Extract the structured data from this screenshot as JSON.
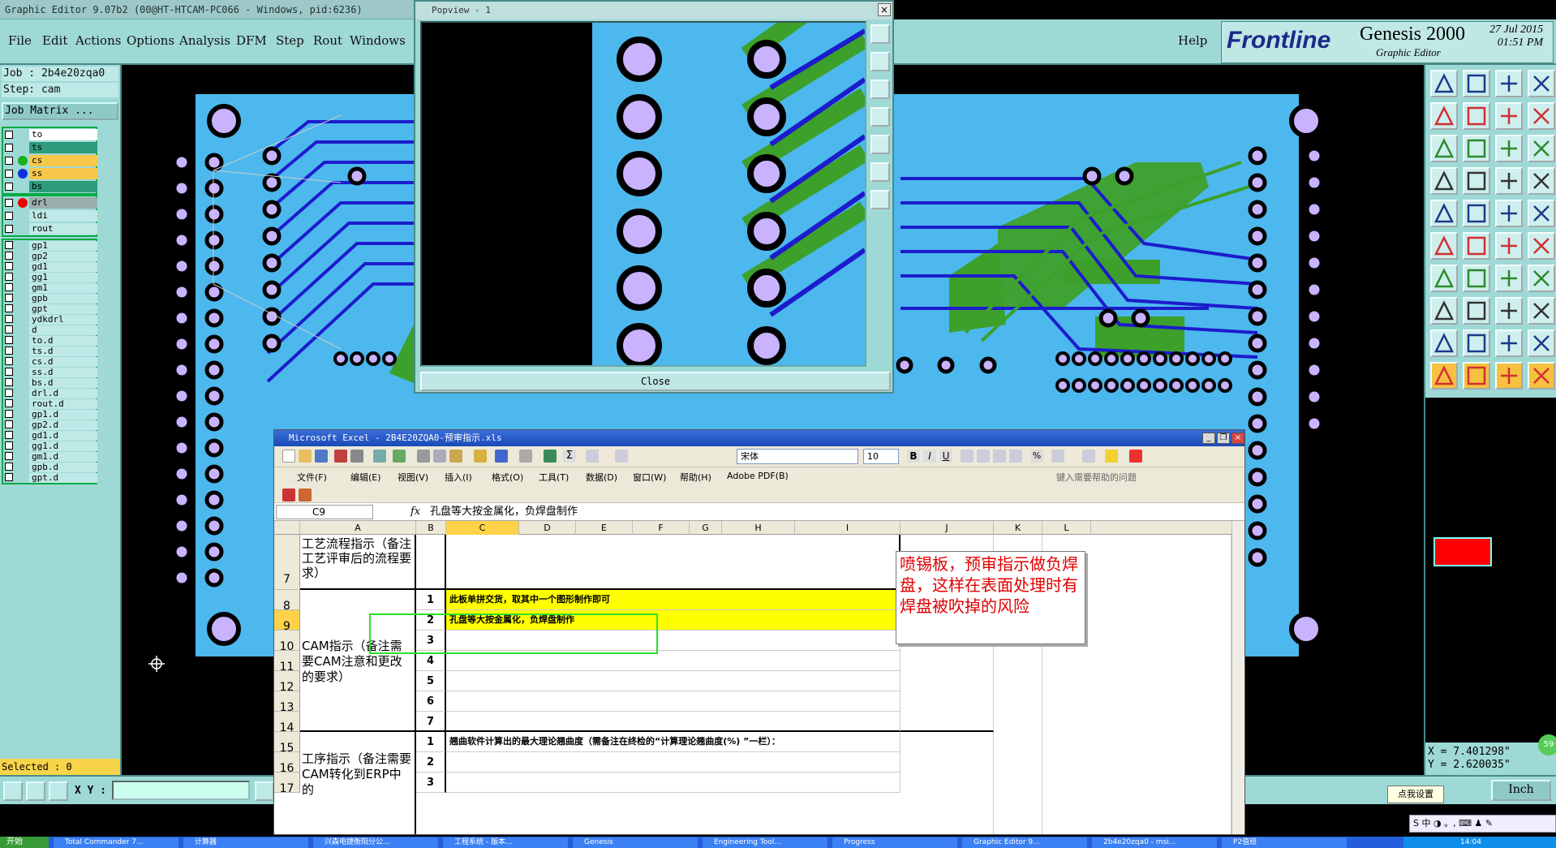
{
  "genesis": {
    "title": "Graphic Editor 9.07b2 (00@HT-HTCAM-PC066 - Windows, pid:6236)",
    "menu": [
      "File",
      "Edit",
      "Actions",
      "Options",
      "Analysis",
      "DFM",
      "Step",
      "Rout",
      "Windows"
    ],
    "help": "Help",
    "logo_brand": "Frontline",
    "logo_product": "Genesis 2000",
    "logo_sub": "Graphic Editor",
    "date": "27 Jul 2015",
    "time": "01:51 PM",
    "job": "Job : 2b4e20zqa0",
    "step": "Step: cam",
    "job_matrix": "Job Matrix ...",
    "layers_top": [
      {
        "name": "to",
        "color": "#ffffff",
        "dot": ""
      },
      {
        "name": "ts",
        "color": "#2e9b7a",
        "dot": ""
      },
      {
        "name": "cs",
        "color": "#f7c84a",
        "dot": "#1ab01a"
      },
      {
        "name": "ss",
        "color": "#f7c84a",
        "dot": "#1030e0"
      },
      {
        "name": "bs",
        "color": "#2e9b7a",
        "dot": ""
      }
    ],
    "layers_drill": [
      {
        "name": "drl",
        "color": "#9aaeae",
        "dot": "#f00000"
      },
      {
        "name": "ldi",
        "color": "#bfe9e6",
        "dot": ""
      },
      {
        "name": "rout",
        "color": "#bfe9e6",
        "dot": ""
      }
    ],
    "layers_other": [
      "gp1",
      "gp2",
      "gd1",
      "gg1",
      "gm1",
      "gpb",
      "gpt",
      "ydkdrl",
      "d",
      "to.d",
      "ts.d",
      "cs.d",
      "ss.d",
      "bs.d",
      "drl.d",
      "rout.d",
      "gp1.d",
      "gp2.d",
      "gd1.d",
      "gg1.d",
      "gm1.d",
      "gpb.d",
      "gpt.d"
    ],
    "selected": "Selected : 0",
    "xy_label": "X Y :",
    "inch": "Inch",
    "coord_x": "X = 7.401298\"",
    "coord_y": "Y = 2.620035\"",
    "zoom_badge": "59"
  },
  "popview": {
    "title": "Popview - 1",
    "close": "Close"
  },
  "excel": {
    "title": "Microsoft Excel - 2B4E20ZQA0-预审指示.xls",
    "menus": [
      "文件(F)",
      "编辑(E)",
      "视图(V)",
      "插入(I)",
      "格式(O)",
      "工具(T)",
      "数据(D)",
      "窗口(W)",
      "帮助(H)",
      "Adobe PDF(B)"
    ],
    "help_box": "键入需要帮助的问题",
    "font": "宋体",
    "font_size": "10",
    "namebox": "C9",
    "formula": "孔盘等大按金属化，负焊盘制作",
    "columns": [
      "A",
      "B",
      "C",
      "D",
      "E",
      "F",
      "G",
      "H",
      "I",
      "J",
      "K",
      "L"
    ],
    "rows": [
      "7",
      "8",
      "9",
      "10",
      "11",
      "12",
      "13",
      "14",
      "15",
      "16",
      "17"
    ],
    "a7": "工艺流程指示（备注工艺评审后的流程要求）",
    "a8": "CAM指示（备注需要CAM注意和更改的要求）",
    "a15": "工序指示（备注需要CAM转化到ERP中的",
    "b_nums": [
      "1",
      "2",
      "3",
      "4",
      "5",
      "6",
      "7",
      "1",
      "2",
      "3"
    ],
    "c8": "此板单拼交货，取其中一个图形制作即可",
    "c9": "孔盘等大按金属化，负焊盘制作",
    "c15": "翘曲软件计算出的最大理论翘曲度（需备注在终检的“计算理论翘曲度(%) ”一栏）：",
    "callout": "喷锡板，预审指示做负焊盘，这样在表面处理时有焊盘被吹掉的风险"
  },
  "taskbar": {
    "start": "开始",
    "tasks": [
      "Total Commander 7...",
      "计算器",
      "兴森电捷衡阳分公...",
      "工程系统 - 版本...",
      "Genesis",
      "Engineering Tool...",
      "Progress",
      "Graphic Editor 9...",
      "2b4e20zqa0 - msi...",
      "P2值班"
    ],
    "clock": "14:04"
  },
  "ime": {
    "tip": "点我设置",
    "bar": "S 中 ◑ 。, ⌨ ♟ ✎"
  }
}
